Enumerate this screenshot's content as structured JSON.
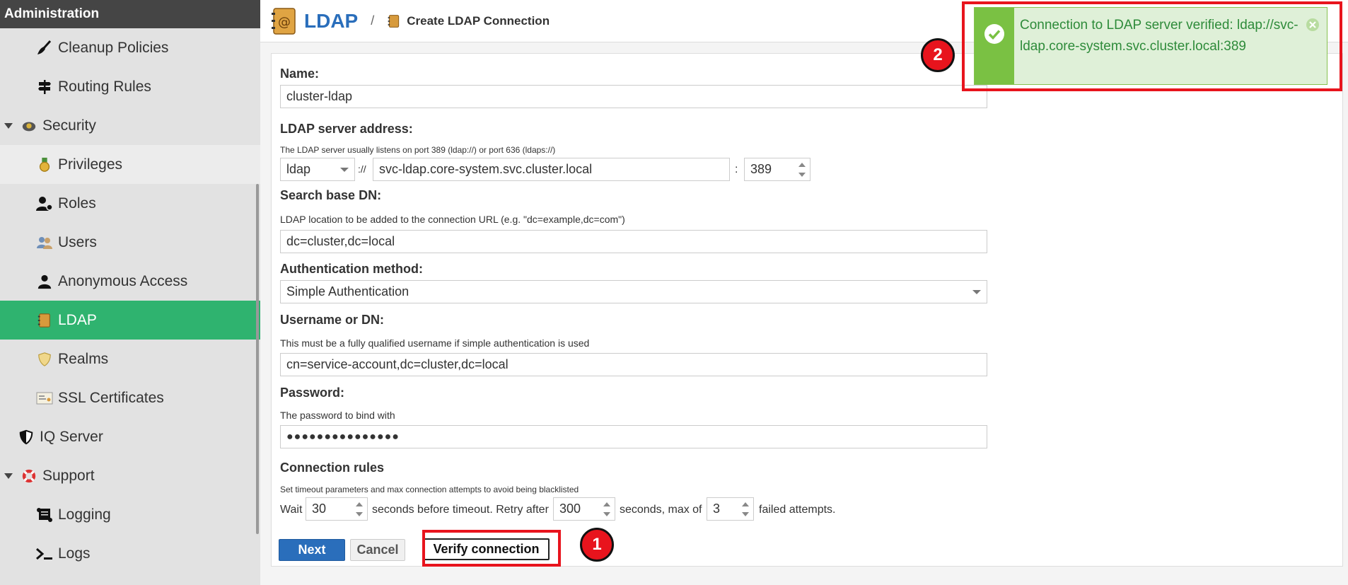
{
  "sidebar": {
    "header": "Administration",
    "items": [
      {
        "label": "Cleanup Policies",
        "icon": "broom-icon"
      },
      {
        "label": "Routing Rules",
        "icon": "signpost-icon"
      },
      {
        "label": "Security",
        "icon": "security-icon"
      },
      {
        "label": "Privileges",
        "icon": "medal-icon"
      },
      {
        "label": "Roles",
        "icon": "user-role-icon"
      },
      {
        "label": "Users",
        "icon": "users-icon"
      },
      {
        "label": "Anonymous Access",
        "icon": "user-icon"
      },
      {
        "label": "LDAP",
        "icon": "address-book-icon"
      },
      {
        "label": "Realms",
        "icon": "shield-icon"
      },
      {
        "label": "SSL Certificates",
        "icon": "certificate-icon"
      },
      {
        "label": "IQ Server",
        "icon": "shield-half-icon"
      },
      {
        "label": "Support",
        "icon": "lifebuoy-icon"
      },
      {
        "label": "Logging",
        "icon": "scroll-icon"
      },
      {
        "label": "Logs",
        "icon": "terminal-icon"
      }
    ]
  },
  "header": {
    "title": "LDAP",
    "separator": "/",
    "subtitle": "Create LDAP Connection"
  },
  "form": {
    "name_label": "Name:",
    "name_value": "cluster-ldap",
    "server_label": "LDAP server address:",
    "server_hint": "The LDAP server usually listens on port 389 (ldap://) or port 636 (ldaps://)",
    "protocol_value": "ldap",
    "protocol_sep": "://",
    "host_value": "svc-ldap.core-system.svc.cluster.local",
    "port_sep": ":",
    "port_value": "389",
    "base_label": "Search base DN:",
    "base_hint": "LDAP location to be added to the connection URL (e.g. \"dc=example,dc=com\")",
    "base_value": "dc=cluster,dc=local",
    "auth_label": "Authentication method:",
    "auth_value": "Simple Authentication",
    "user_label": "Username or DN:",
    "user_hint": "This must be a fully qualified username if simple authentication is used",
    "user_value": "cn=service-account,dc=cluster,dc=local",
    "pass_label": "Password:",
    "pass_hint": "The password to bind with",
    "pass_value": "●●●●●●●●●●●●●●●",
    "rules_label": "Connection rules",
    "rules_hint": "Set timeout parameters and max connection attempts to avoid being blacklisted",
    "wait_text": "Wait",
    "timeout_value": "30",
    "timeout_text": "seconds before timeout. Retry after",
    "retry_value": "300",
    "retry_text": "seconds, max of",
    "max_value": "3",
    "max_text": "failed attempts."
  },
  "buttons": {
    "next": "Next",
    "cancel": "Cancel",
    "verify": "Verify connection"
  },
  "annotations": {
    "badge1": "1",
    "badge2": "2"
  },
  "toast": {
    "message": "Connection to LDAP server verified: ldap://svc-ldap.core-system.svc.cluster.local:389"
  },
  "colors": {
    "accent": "#2a6ebb",
    "active": "#2fb36f",
    "success": "#2e8b3a",
    "annotation": "#e8141d"
  }
}
